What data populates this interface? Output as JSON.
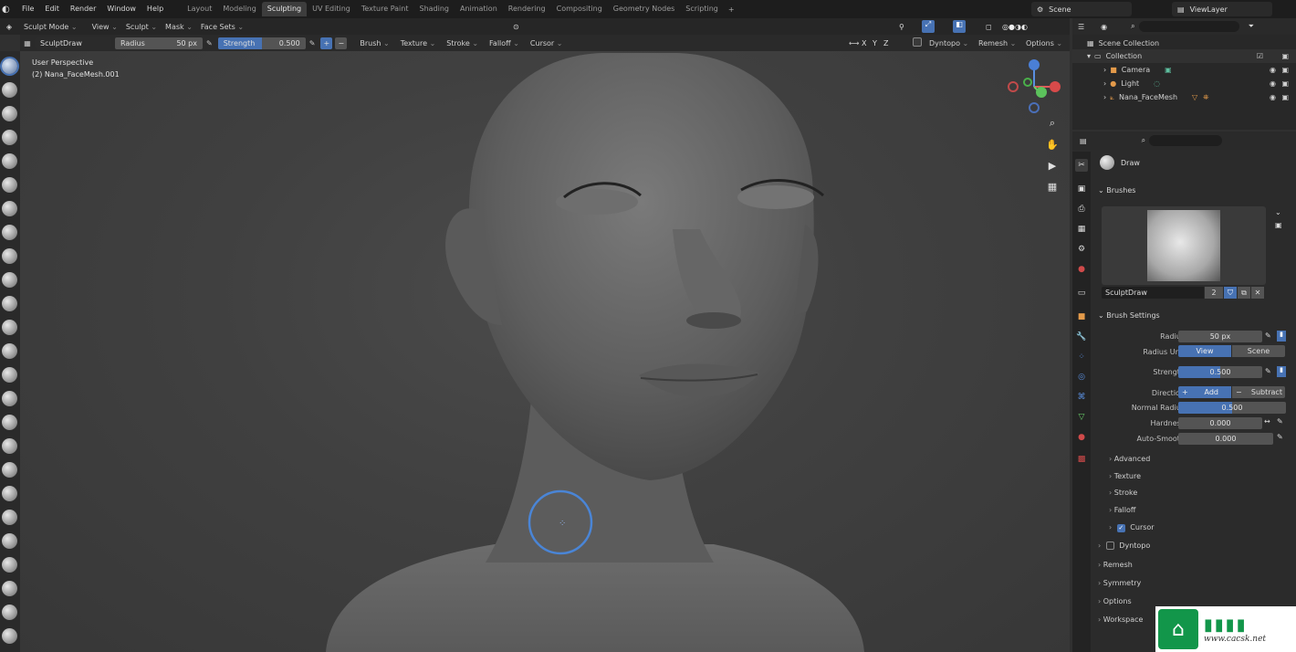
{
  "menu": [
    "File",
    "Edit",
    "Render",
    "Window",
    "Help"
  ],
  "workspaces": [
    {
      "label": "Layout",
      "active": false
    },
    {
      "label": "Modeling",
      "active": false
    },
    {
      "label": "Sculpting",
      "active": true
    },
    {
      "label": "UV Editing",
      "active": false
    },
    {
      "label": "Texture Paint",
      "active": false
    },
    {
      "label": "Shading",
      "active": false
    },
    {
      "label": "Animation",
      "active": false
    },
    {
      "label": "Rendering",
      "active": false
    },
    {
      "label": "Compositing",
      "active": false
    },
    {
      "label": "Geometry Nodes",
      "active": false
    },
    {
      "label": "Scripting",
      "active": false
    }
  ],
  "scene_name": "Scene",
  "view_layer": "ViewLayer",
  "header": {
    "mode": "Sculpt Mode",
    "menus": [
      "View",
      "Sculpt",
      "Mask",
      "Face Sets"
    ]
  },
  "tool_settings": {
    "brush_name": "SculptDraw",
    "radius_label": "Radius",
    "radius_value": "50 px",
    "strength_label": "Strength",
    "strength_value": "0.500",
    "dropdowns": [
      "Brush",
      "Texture",
      "Stroke",
      "Falloff",
      "Cursor"
    ],
    "axes": [
      "X",
      "Y",
      "Z"
    ],
    "right": [
      "Dyntopo",
      "Remesh",
      "Options"
    ]
  },
  "viewport": {
    "perspective": "User Perspective",
    "object": "(2) Nana_FaceMesh.001"
  },
  "outliner": {
    "root": "Scene Collection",
    "collection": "Collection",
    "items": [
      "Camera",
      "Light",
      "Nana_FaceMesh"
    ]
  },
  "properties": {
    "tool_name": "Draw",
    "brushes_header": "Brushes",
    "brush_name": "SculptDraw",
    "brush_users": "2",
    "brush_settings_header": "Brush Settings",
    "radius_label": "Radius",
    "radius_value": "50 px",
    "radius_unit_label": "Radius Unit",
    "unit_view": "View",
    "unit_scene": "Scene",
    "strength_label": "Strength",
    "strength_value": "0.500",
    "strength_fraction": 0.5,
    "direction_label": "Direction",
    "dir_add": "Add",
    "dir_subtract": "Subtract",
    "normal_radius_label": "Normal Radius",
    "normal_radius_value": "0.500",
    "normal_radius_fraction": 0.5,
    "hardness_label": "Hardness",
    "hardness_value": "0.000",
    "autosmooth_label": "Auto-Smooth",
    "autosmooth_value": "0.000",
    "subpanels": [
      "Advanced",
      "Texture",
      "Stroke",
      "Falloff",
      "Cursor"
    ],
    "panels": [
      "Dyntopo",
      "Remesh",
      "Symmetry",
      "Options",
      "Workspace"
    ]
  },
  "watermark": {
    "site": "www.cacsk.net"
  },
  "colors": {
    "accent": "#4772b3",
    "header": "#1d1d1d",
    "viewport": "#404040",
    "panel": "#2b2b2b"
  }
}
